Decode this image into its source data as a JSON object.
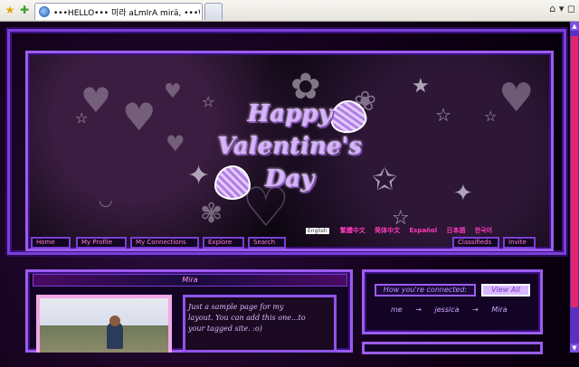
{
  "browser": {
    "tab_title": "•••HELLO••• 미라 aLmIrA mirä, •••Welcome...",
    "star_icon": "star-icon",
    "add_icon": "add-favorites-icon",
    "home_icon": "home-icon"
  },
  "banner": {
    "title_line1": "Happy",
    "title_line2": "Valentine's",
    "title_line3": "Day"
  },
  "languages": {
    "english": "English",
    "items": [
      "繁體中文",
      "简体中文",
      "Español",
      "日本語",
      "한국어"
    ]
  },
  "nav": {
    "home": "Home",
    "my_profile": "My Profile",
    "my_connections": "My Connections",
    "explore": "Explore",
    "search": "Search",
    "classifieds": "Classifieds",
    "invite": "Invite"
  },
  "profile": {
    "name": "Mira",
    "intro": "Just a sample page for my layout. You can add this one...to your tagged site. :o)"
  },
  "connections": {
    "label": "How you're connected:",
    "view_all": "View All",
    "from": "me",
    "via": "jessica",
    "to": "Mira",
    "arrow": "→"
  },
  "colors": {
    "frame": "#9b5cf0",
    "accent_pink": "#ff3bbd",
    "scroll_thumb": "#e1266a"
  }
}
